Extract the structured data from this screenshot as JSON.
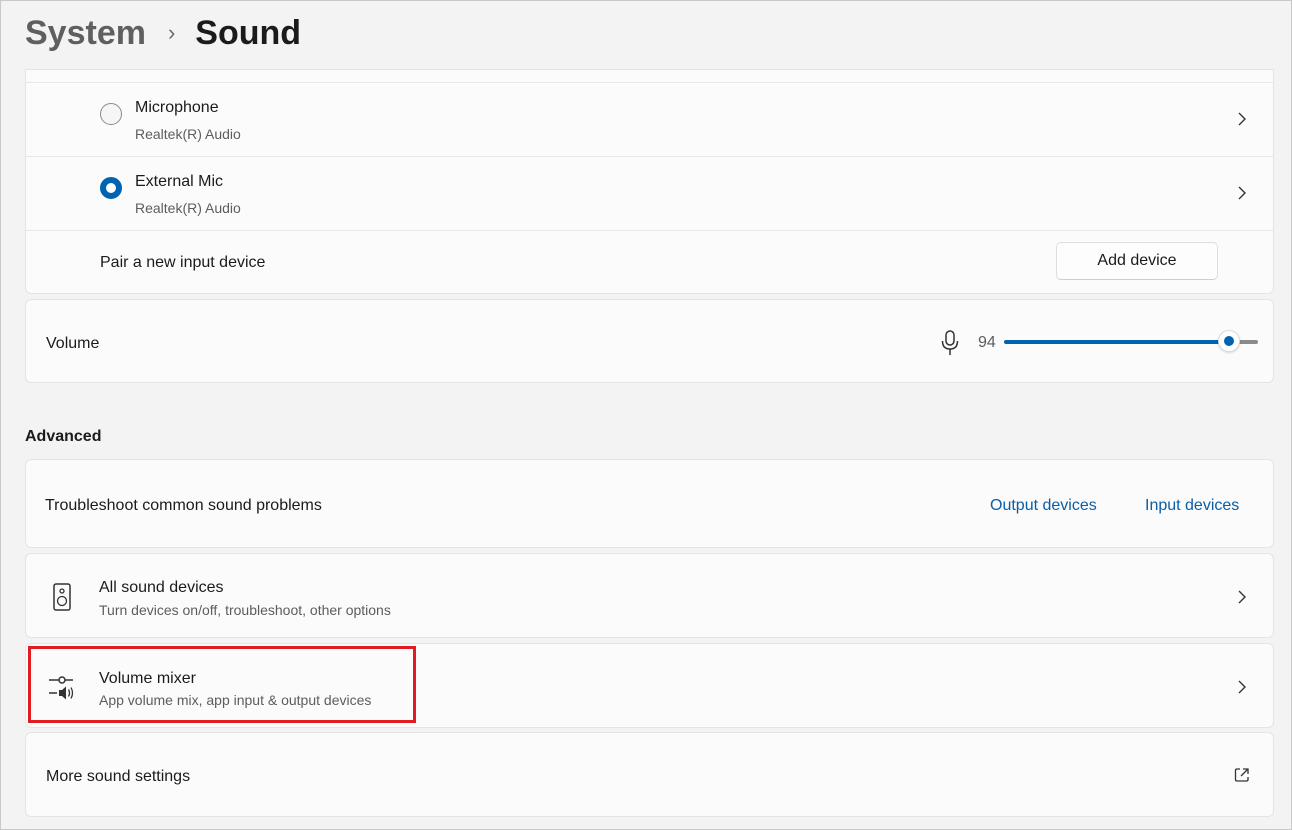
{
  "breadcrumb": {
    "parent": "System",
    "separator": "›",
    "current": "Sound"
  },
  "input_devices": [
    {
      "name": "Microphone",
      "detail": "Realtek(R) Audio",
      "selected": false
    },
    {
      "name": "External Mic",
      "detail": "Realtek(R) Audio",
      "selected": true
    }
  ],
  "pair_device": {
    "label": "Pair a new input device",
    "button": "Add device"
  },
  "volume": {
    "label": "Volume",
    "value_text": "94",
    "value": 94,
    "icon": "microphone-icon"
  },
  "advanced": {
    "heading": "Advanced",
    "troubleshoot": {
      "label": "Troubleshoot common sound problems",
      "link_output": "Output devices",
      "link_input": "Input devices"
    },
    "all_sound_devices": {
      "title": "All sound devices",
      "subtitle": "Turn devices on/off, troubleshoot, other options",
      "icon": "speaker-icon"
    },
    "volume_mixer": {
      "title": "Volume mixer",
      "subtitle": "App volume mix, app input & output devices",
      "icon": "volume-mixer-icon"
    },
    "more_settings": {
      "label": "More sound settings",
      "icon": "external-link-icon"
    }
  },
  "colors": {
    "accent": "#0063b1",
    "link": "#0a5ea8",
    "highlight": "#e11b22"
  }
}
